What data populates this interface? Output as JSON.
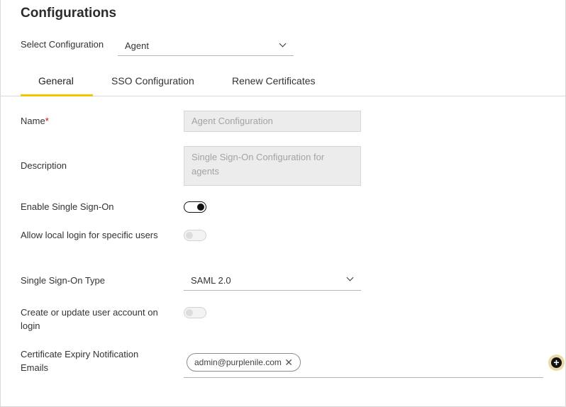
{
  "page": {
    "title": "Configurations"
  },
  "select_configuration": {
    "label": "Select Configuration",
    "value": "Agent"
  },
  "tabs": [
    {
      "label": "General",
      "active": true
    },
    {
      "label": "SSO Configuration",
      "active": false
    },
    {
      "label": "Renew Certificates",
      "active": false
    }
  ],
  "form": {
    "name": {
      "label": "Name",
      "required_mark": "*",
      "value": "Agent Configuration"
    },
    "description": {
      "label": "Description",
      "value": "Single Sign-On Configuration for agents"
    },
    "enable_sso": {
      "label": "Enable Single Sign-On",
      "enabled": true
    },
    "allow_local_login": {
      "label": "Allow local login for specific users",
      "enabled": false
    },
    "sso_type": {
      "label": "Single Sign-On Type",
      "value": "SAML 2.0"
    },
    "create_update_account": {
      "label": "Create or update user account on login",
      "enabled": false
    },
    "cert_expiry_emails": {
      "label": "Certificate Expiry Notification Emails",
      "chips": [
        "admin@purplenile.com"
      ],
      "remove_glyph": "✕",
      "add_glyph": "+"
    }
  },
  "colors": {
    "tab_active_underline": "#f5c400",
    "required": "#d0021b",
    "toggle_on": "#111111"
  },
  "icons": {
    "dropdown": "chevron-down-icon",
    "chip_remove": "close-icon",
    "add": "plus-circle-icon"
  }
}
